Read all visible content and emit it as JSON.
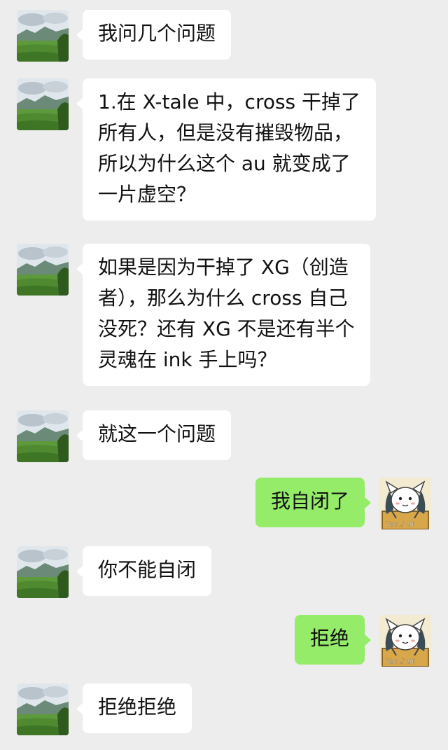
{
  "conversation": {
    "messages": [
      {
        "sender": "other",
        "text": "我问几个问题"
      },
      {
        "sender": "other",
        "text": "1.在 X-tale 中，cross 干掉了\n所有人，但是没有摧毁物品，\n所以为什么这个 au 就变成了\n一片虚空？"
      },
      {
        "sender": "other",
        "text": "如果是因为干掉了 XG（创造\n者），那么为什么 cross 自己\n没死？还有 XG 不是还有半个\n灵魂在 ink 手上吗？"
      },
      {
        "sender": "other",
        "text": "就这一个问题"
      },
      {
        "sender": "me",
        "text": "我自闭了"
      },
      {
        "sender": "other",
        "text": "你不能自闭"
      },
      {
        "sender": "me",
        "text": "拒绝"
      },
      {
        "sender": "other",
        "text": "拒绝拒绝"
      }
    ],
    "my_avatar_caption": "Tem5 9P"
  },
  "colors": {
    "background": "#ededed",
    "incoming_bubble": "#ffffff",
    "outgoing_bubble": "#95ec69"
  },
  "avatars": {
    "other": "landscape-avatar-icon",
    "me": "temmie-avatar-icon"
  }
}
